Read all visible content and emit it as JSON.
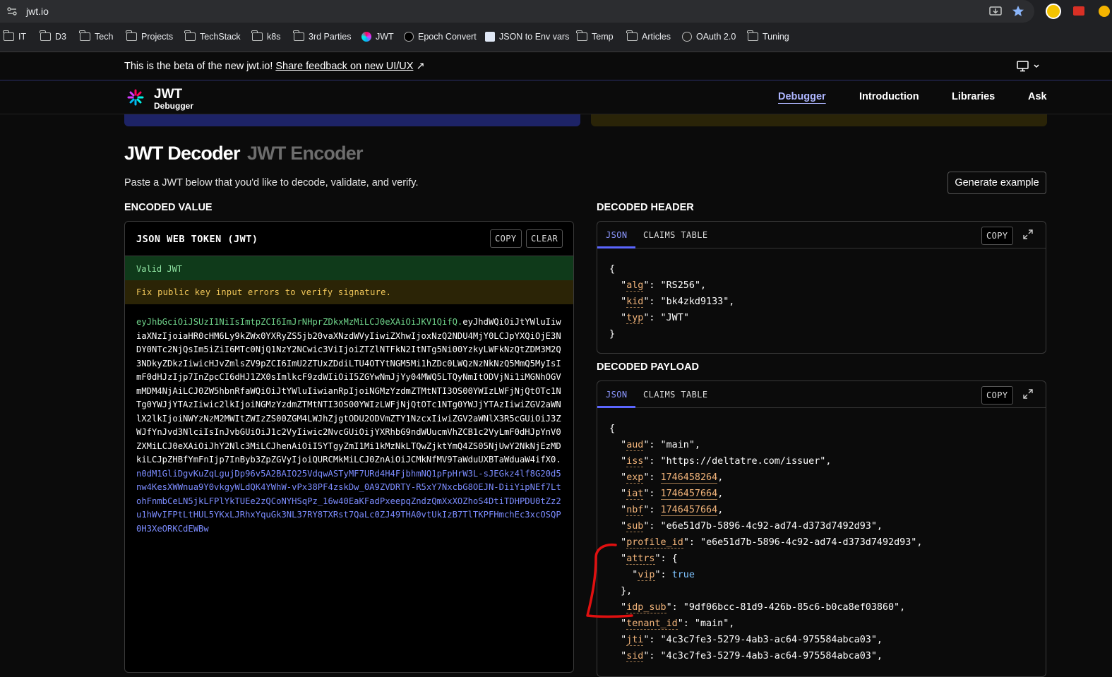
{
  "browser": {
    "url": "jwt.io",
    "bookmarks": [
      "IT",
      "D3",
      "Tech",
      "Projects",
      "TechStack",
      "k8s",
      "3rd Parties",
      "JWT",
      "Epoch Convert",
      "JSON to Env vars",
      "Temp",
      "Articles",
      "OAuth 2.0",
      "Tuning"
    ]
  },
  "banner": {
    "text": "This is the beta of the new jwt.io!",
    "link": "Share feedback on new UI/UX"
  },
  "header": {
    "logo_title": "JWT",
    "logo_sub": "Debugger",
    "nav": [
      "Debugger",
      "Introduction",
      "Libraries",
      "Ask"
    ]
  },
  "main": {
    "title_decoder": "JWT Decoder",
    "title_encoder": "JWT Encoder",
    "subtitle": "Paste a JWT below that you'd like to decode, validate, and verify.",
    "generate_btn": "Generate example"
  },
  "encoded": {
    "section_label": "ENCODED VALUE",
    "panel_title": "JSON WEB TOKEN (JWT)",
    "copy_label": "COPY",
    "clear_label": "CLEAR",
    "valid_text": "Valid JWT",
    "warn_text": "Fix public key input errors to verify signature.",
    "token_header": "eyJhbGciOiJSUzI1NiIsImtpZCI6ImJrNHprZDkxMzMiLCJ0eXAiOiJKV1QifQ.",
    "token_payload": "eyJhdWQiOiJtYWluIiwiaXNzIjoiaHR0cHM6Ly9kZWx0YXRyZS5jb20vaXNzdWVyIiwiZXhwIjoxNzQ2NDU4MjY0LCJpYXQiOjE3NDY0NTc2NjQsIm5iZiI6MTc0NjQ1NzY2NCwic3ViIjoiZTZlNTFkN2ItNTg5Ni00YzkyLWFkNzQtZDM3M2Q3NDkyZDkzIiwicHJvZmlsZV9pZCI6ImU2ZTUxZDdiLTU4OTYtNGM5Mi1hZDc0LWQzNzNkNzQ5MmQ5MyIsImF0dHJzIjp7InZpcCI6dHJ1ZX0sImlkcF9zdWIiOiI5ZGYwNmJjYy04MWQ5LTQyNmItODVjNi1iMGNhOGVmMDM4NjAiLCJ0ZW5hbnRfaWQiOiJtYWluIiwianRpIjoiNGMzYzdmZTMtNTI3OS00YWIzLWFjNjQtOTc1NTg0YWJjYTAzIiwic2lkIjoiNGMzYzdmZTMtNTI3OS00YWIzLWFjNjQtOTc1NTg0YWJjYTAzIiwiZGV2aWNlX2lkIjoiNWYzNzM2MWItZWIzZS00ZGM4LWJhZjgtODU2ODVmZTY1NzcxIiwiZGV2aWNlX3R5cGUiOiJ3ZWJfYnJvd3NlciIsInJvbGUiOiJ1c2VyIiwic2NvcGUiOijYXRhbG9ndWUucmVhZCB1c2VyLmF0dHJpYnV0ZXMiLCJ0eXAiOiJhY2Nlc3MiLCJhenAiOiI5YTgyZmI1Mi1kMzNkLTQwZjktYmQ4ZS05NjUwY2NkNjEzMDkiLCJpZHBfYmFnIjp7InByb3ZpZGVyIjoiQURCMkMiLCJ0ZnAiOiJCMkNfMV9TaWduUXBTaWduaW4ifX0.",
    "token_signature": "n0dM1GliDgvKuZqLgujDp96v5A2BAIO25VdqwASTyMF7URd4H4FjbhmNQ1pFpHrW3L-sJEGkz4lf8G20d5nw4KesXWWnua9Y0vkgyWLdQK4YWhW-vPx38PF4zskDw_0A9ZVDRTY-R5xY7NxcbG8OEJN-DiiYipNEf7LtohFnmbCeLN5jkLFPlYkTUEe2zQCoNYHSqPz_16w40EaKFadPxeepqZndzQmXxXOZhoS4DtiTDHPDU0tZz2u1hWvIFPtLtHUL5YKxLJRhxYquGk3NL37RY8TXRst7QaLc0ZJ49THA0vtUkIzB7TlTKPFHmchEc3xcOSQP0H3XeORKCdEWBw"
  },
  "decoded_header": {
    "section_label": "DECODED HEADER",
    "tab_json": "JSON",
    "tab_claims": "CLAIMS TABLE",
    "copy_label": "COPY",
    "alg": "RS256",
    "kid": "bk4zkd9133",
    "typ": "JWT"
  },
  "decoded_payload": {
    "section_label": "DECODED PAYLOAD",
    "tab_json": "JSON",
    "tab_claims": "CLAIMS TABLE",
    "copy_label": "COPY",
    "aud": "main",
    "iss": "https://deltatre.com/issuer",
    "exp": "1746458264",
    "iat": "1746457664",
    "nbf": "1746457664",
    "sub": "e6e51d7b-5896-4c92-ad74-d373d7492d93",
    "profile_id": "e6e51d7b-5896-4c92-ad74-d373d7492d93",
    "vip": "true",
    "idp_sub": "9df06bcc-81d9-426b-85c6-b0ca8ef03860",
    "tenant_id": "main",
    "jti": "4c3c7fe3-5279-4ab3-ac64-975584abca03",
    "sid_partial": "4c3c7fe3-5279-4ab3-ac64-975584abca03"
  },
  "colors": {
    "accent": "#5b66ff",
    "valid_bg": "#0f3a1a",
    "warn_bg": "#2b2406",
    "annotation": "#e01010"
  }
}
